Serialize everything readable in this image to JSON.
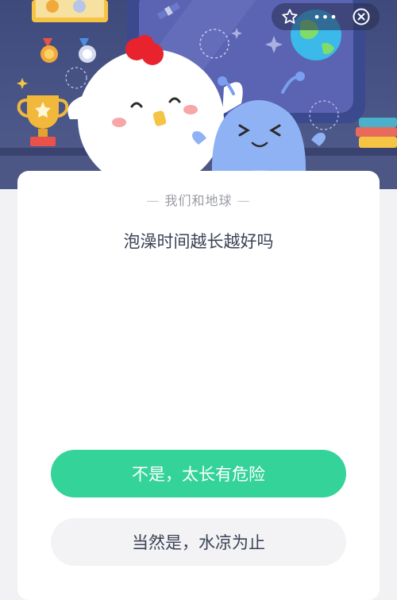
{
  "topbar": {
    "favorite_icon": "star-outline-icon",
    "more_label": "•••",
    "close_icon": "close-circle-icon"
  },
  "quiz": {
    "category": "我们和地球",
    "category_dash": "—",
    "question": "泡澡时间越长越好吗",
    "options": [
      {
        "label": "不是，太长有危险",
        "color": "#33d39a",
        "text_color": "#ffffff"
      },
      {
        "label": "当然是，水凉为止",
        "color": "#f3f3f5",
        "text_color": "#3b4255"
      }
    ]
  },
  "colors": {
    "banner": "#4a5687",
    "accent_green": "#33d39a",
    "page_background": "#f2f2f4"
  }
}
